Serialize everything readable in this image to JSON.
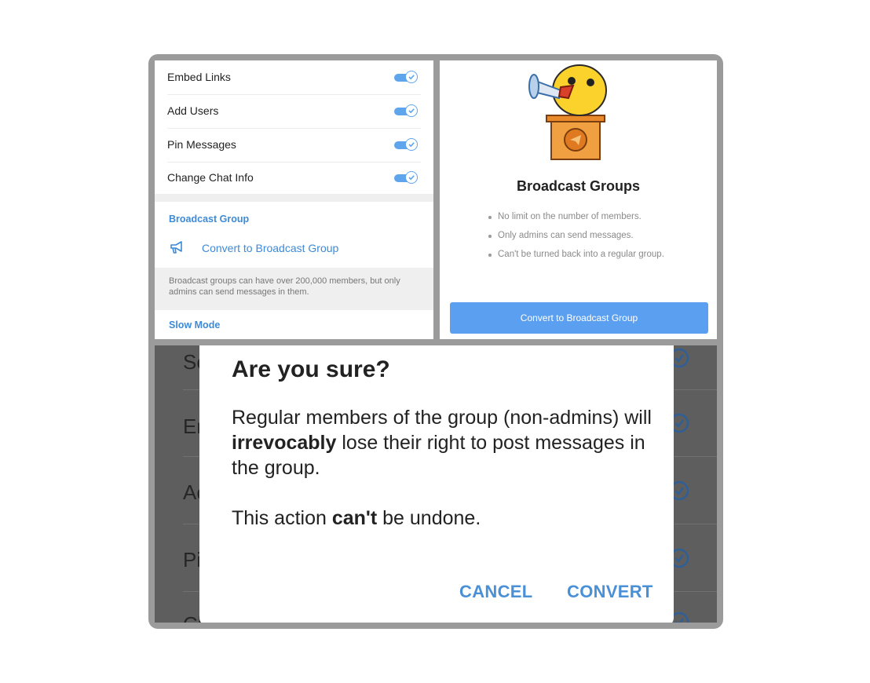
{
  "permissions": [
    {
      "label": "Embed Links",
      "enabled": true
    },
    {
      "label": "Add Users",
      "enabled": true
    },
    {
      "label": "Pin Messages",
      "enabled": true
    },
    {
      "label": "Change Chat Info",
      "enabled": true
    }
  ],
  "broadcast_section": {
    "header": "Broadcast Group",
    "convert_label": "Convert to Broadcast Group",
    "info": "Broadcast groups can have over 200,000 members, but only admins can send messages in them."
  },
  "slow_mode_header": "Slow Mode",
  "promo": {
    "title": "Broadcast Groups",
    "bullets": [
      "No limit on the number of members.",
      "Only admins can send messages.",
      "Can't be turned back into a regular group."
    ],
    "button": "Convert to Broadcast Group"
  },
  "dialog": {
    "title": "Are you sure?",
    "body_before": "Regular members of the group (non-admins) will ",
    "body_bold": "irrevocably",
    "body_after": " lose their right to post messages in the group.",
    "note_before": "This action ",
    "note_bold": "can't",
    "note_after": " be undone.",
    "cancel": "CANCEL",
    "convert": "CONVERT"
  },
  "background_rows": [
    "Se",
    "Er",
    "Ac",
    "Pi",
    "Cl"
  ],
  "colors": {
    "accent": "#3d8ad8",
    "toggle": "#5fa5ec",
    "button": "#5b9ff0",
    "dim": "#5e5e5e"
  }
}
